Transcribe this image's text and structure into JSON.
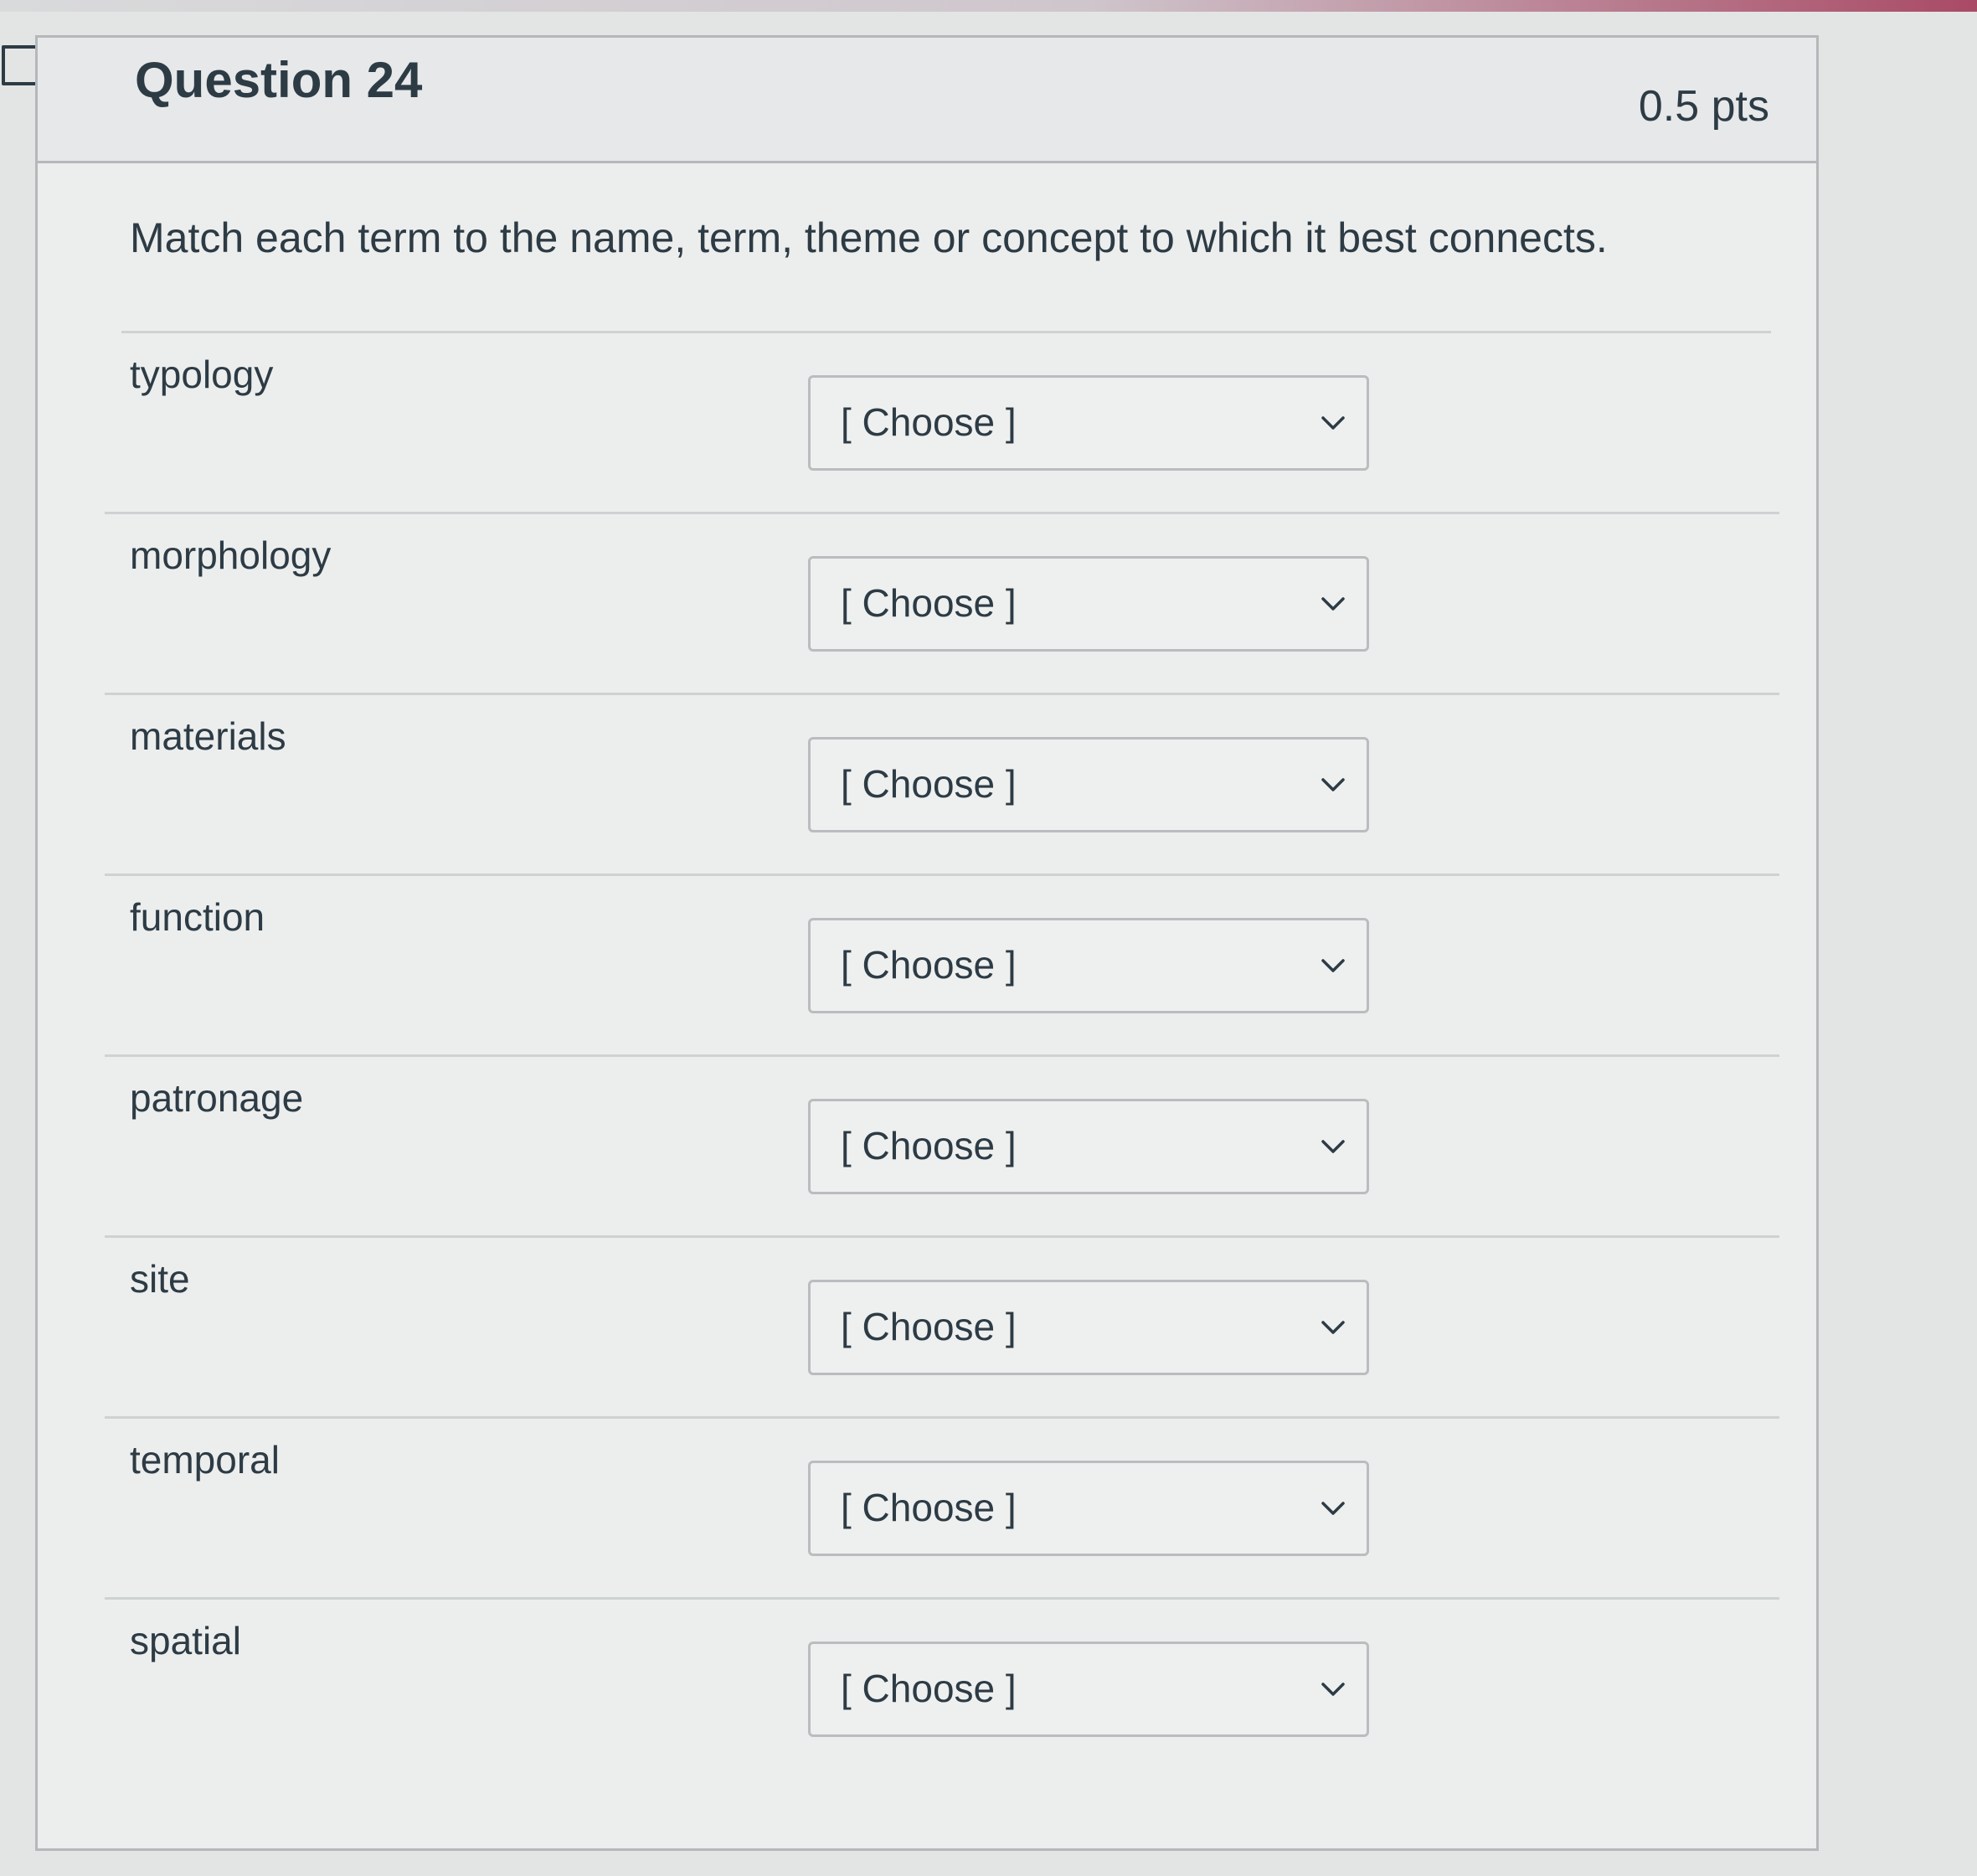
{
  "question": {
    "title": "Question 24",
    "points": "0.5 pts",
    "prompt": "Match each term to the name, term, theme or concept to which it best connects."
  },
  "rows": [
    {
      "term": "typology",
      "select": "[ Choose ]"
    },
    {
      "term": "morphology",
      "select": "[ Choose ]"
    },
    {
      "term": "materials",
      "select": "[ Choose ]"
    },
    {
      "term": "function",
      "select": "[ Choose ]"
    },
    {
      "term": "patronage",
      "select": "[ Choose ]"
    },
    {
      "term": "site",
      "select": "[ Choose ]"
    },
    {
      "term": "temporal",
      "select": "[ Choose ]"
    },
    {
      "term": "spatial",
      "select": "[ Choose ]"
    }
  ],
  "icons": {
    "flag": "bookmark-flag-icon",
    "dropdown": "chevron-down-icon"
  },
  "colors": {
    "text": "#2d3b45",
    "border": "#b4b8ba",
    "accent_strip": "#a94a66"
  }
}
